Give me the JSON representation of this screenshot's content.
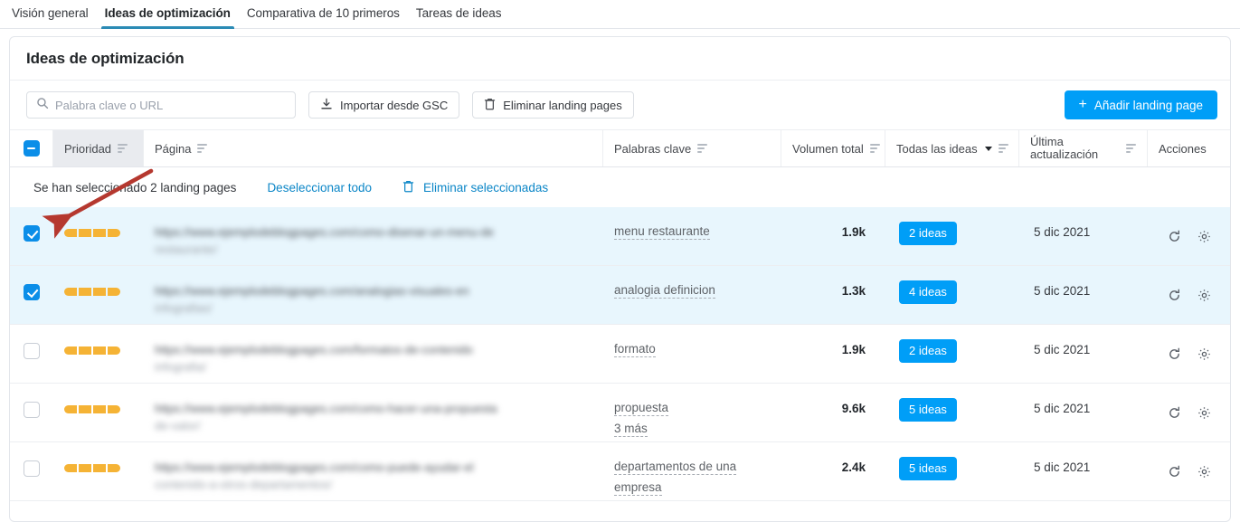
{
  "tabs": [
    {
      "label": "Visión general",
      "active": false
    },
    {
      "label": "Ideas de optimización",
      "active": true
    },
    {
      "label": "Comparativa de 10 primeros",
      "active": false
    },
    {
      "label": "Tareas de ideas",
      "active": false
    }
  ],
  "card": {
    "title": "Ideas de optimización"
  },
  "toolbar": {
    "search_placeholder": "Palabra clave o URL",
    "search_value": "",
    "import_gsc_label": "Importar desde GSC",
    "delete_landing_label": "Eliminar landing pages",
    "add_landing_label": "Añadir landing page",
    "add_plus": "+"
  },
  "table": {
    "headers": {
      "priority": "Prioridad",
      "page": "Página",
      "keywords": "Palabras clave",
      "total_volume": "Volumen total",
      "ideas_filter": "Todas las ideas",
      "last_update_line1": "Última",
      "last_update_line2": "actualización",
      "actions": "Acciones"
    }
  },
  "selection_bar": {
    "summary": "Se han seleccionado 2 landing pages",
    "deselect_all": "Deseleccionar todo",
    "delete_selected": "Eliminar seleccionadas"
  },
  "rows": [
    {
      "selected": true,
      "priority_segments": 4,
      "url_line1": "https://www.ejemplodeblogpages.com/como-disenar-un-menu-de",
      "url_line2": "restaurante/",
      "keywords": [
        "menu restaurante"
      ],
      "volume": "1.9k",
      "ideas": "2 ideas",
      "updated": "5 dic 2021"
    },
    {
      "selected": true,
      "priority_segments": 4,
      "url_line1": "https://www.ejemplodeblogpages.com/analogias-visuales-en",
      "url_line2": "infografias/",
      "keywords": [
        "analogia definicion"
      ],
      "volume": "1.3k",
      "ideas": "4 ideas",
      "updated": "5 dic 2021"
    },
    {
      "selected": false,
      "priority_segments": 4,
      "url_line1": "https://www.ejemplodeblogpages.com/formatos-de-contenido",
      "url_line2": "infografia/",
      "keywords": [
        "formato"
      ],
      "volume": "1.9k",
      "ideas": "2 ideas",
      "updated": "5 dic 2021"
    },
    {
      "selected": false,
      "priority_segments": 4,
      "url_line1": "https://www.ejemplodeblogpages.com/como-hacer-una-propuesta",
      "url_line2": "de-valor/",
      "keywords": [
        "propuesta",
        "3 más"
      ],
      "volume": "9.6k",
      "ideas": "5 ideas",
      "updated": "5 dic 2021"
    },
    {
      "selected": false,
      "priority_segments": 4,
      "url_line1": "https://www.ejemplodeblogpages.com/como-puede-ayudar-el",
      "url_line2": "contenido-a-otros-departamentos/",
      "keywords": [
        "departamentos de una",
        "empresa"
      ],
      "volume": "2.4k",
      "ideas": "5 ideas",
      "updated": "5 dic 2021"
    }
  ],
  "icons": {
    "search": "search-icon",
    "import": "download-icon",
    "trash": "trash-icon",
    "refresh": "refresh-icon",
    "gear": "gear-icon",
    "sort": "sort-icon"
  },
  "colors": {
    "accent_blue": "#009ef7",
    "link_blue": "#0b86c7",
    "tab_underline": "#2b8bb5",
    "priority_orange": "#f5b335",
    "selected_row": "#e8f6fd",
    "annotation_red": "#b5382f"
  },
  "annotation": {
    "type": "arrow",
    "points_to": "row-1-checkbox"
  }
}
